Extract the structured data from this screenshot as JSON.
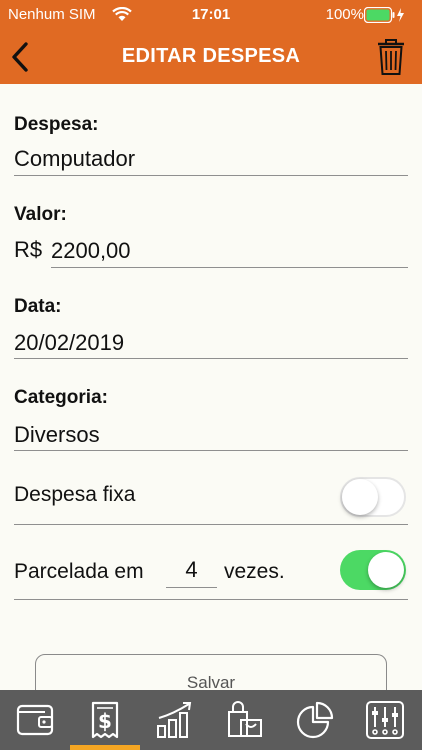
{
  "status_bar": {
    "carrier": "Nenhum SIM",
    "time": "17:01",
    "battery": "100%"
  },
  "nav": {
    "title": "EDITAR DESPESA"
  },
  "form": {
    "despesa_label": "Despesa:",
    "despesa_value": "Computador",
    "valor_label": "Valor:",
    "currency": "R$",
    "valor_value": "2200,00",
    "data_label": "Data:",
    "data_value": "20/02/2019",
    "categoria_label": "Categoria:",
    "categoria_value": "Diversos",
    "fixa_label": "Despesa fixa",
    "fixa_on": false,
    "parcelada_prefix": "Parcelada em",
    "parcelas": "4",
    "parcelada_suffix": "vezes.",
    "parcelada_on": true
  },
  "save_label": "Salvar",
  "tabs": [
    {
      "icon": "wallet-icon",
      "active": false
    },
    {
      "icon": "bill-icon",
      "active": true
    },
    {
      "icon": "growth-chart-icon",
      "active": false
    },
    {
      "icon": "shopping-bags-icon",
      "active": false
    },
    {
      "icon": "pie-chart-icon",
      "active": false
    },
    {
      "icon": "sliders-icon",
      "active": false
    }
  ],
  "colors": {
    "header": "#E06A23",
    "tabbar": "#5C5C5C",
    "tab_active": "#F5A623",
    "toggle_on": "#4CD964"
  }
}
